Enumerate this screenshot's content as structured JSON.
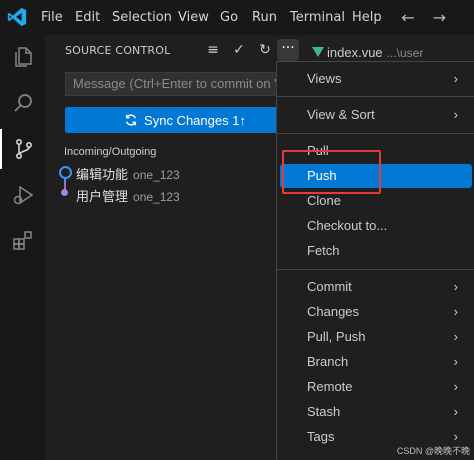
{
  "titlebar": {
    "menus": [
      "File",
      "Edit",
      "Selection",
      "View",
      "Go",
      "Run",
      "Terminal",
      "Help"
    ],
    "nav_arrows": "←→"
  },
  "source_control": {
    "title": "SOURCE CONTROL",
    "more_label": "···",
    "message_placeholder": "Message (Ctrl+Enter to commit on \"...",
    "sync_label": "Sync Changes 1↑",
    "section_header": "Incoming/Outgoing",
    "commits": [
      {
        "message": "编辑功能",
        "author": "one_123"
      },
      {
        "message": "用户管理",
        "author": "one_123"
      }
    ]
  },
  "editor_tab": {
    "filename": "index.vue",
    "path": "...\\user"
  },
  "context_menu": {
    "items": [
      {
        "label": "Views",
        "submenu": true
      },
      {
        "label": "View & Sort",
        "submenu": true
      },
      {
        "label": "Pull",
        "submenu": false
      },
      {
        "label": "Push",
        "submenu": false,
        "selected": true
      },
      {
        "label": "Clone",
        "submenu": false
      },
      {
        "label": "Checkout to...",
        "submenu": false
      },
      {
        "label": "Fetch",
        "submenu": false
      },
      {
        "label": "Commit",
        "submenu": true
      },
      {
        "label": "Changes",
        "submenu": true
      },
      {
        "label": "Pull, Push",
        "submenu": true
      },
      {
        "label": "Branch",
        "submenu": true
      },
      {
        "label": "Remote",
        "submenu": true
      },
      {
        "label": "Stash",
        "submenu": true
      },
      {
        "label": "Tags",
        "submenu": true
      }
    ],
    "chevron": "›"
  },
  "watermark": "CSDN @晚晚不晚",
  "colors": {
    "accent": "#0078d4",
    "highlight_box": "#e63b3b",
    "vue_green": "#41b883"
  }
}
